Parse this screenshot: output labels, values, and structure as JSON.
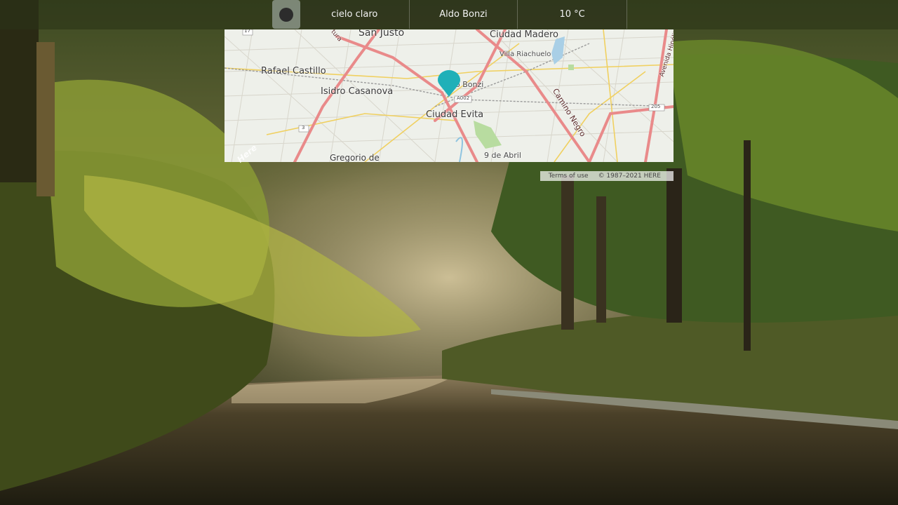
{
  "weather_bar": {
    "condition": "cielo claro",
    "location": "Aldo Bonzi",
    "temperature": "10 °C",
    "icon": "weather-dot-icon"
  },
  "map": {
    "labels": {
      "san_justo": "San Justo",
      "ciudad_madero": "Ciudad Madero",
      "villa_riachuelo": "Villa Riachuelo",
      "rafael_castillo": "Rafael Castillo",
      "isidro_casanova": "Isidro Casanova",
      "aldo_bonzi": "o Bonzi",
      "ciudad_evita": "Ciudad Evita",
      "camino_negro": "Camino Negro",
      "nueve_de_abril": "9 de Abril",
      "gregorio": "Gregorio de",
      "avenida": "Avenida Hipólit",
      "ruta_17": "17",
      "ruta_3": "3",
      "ruta_a002": "A002",
      "ruta_205": "205",
      "tura": "tura"
    },
    "here_logo": "Here",
    "terms": "Terms of use",
    "copyright": "© 1987–2021 HERE",
    "pin_color": "#1fb0b8"
  }
}
